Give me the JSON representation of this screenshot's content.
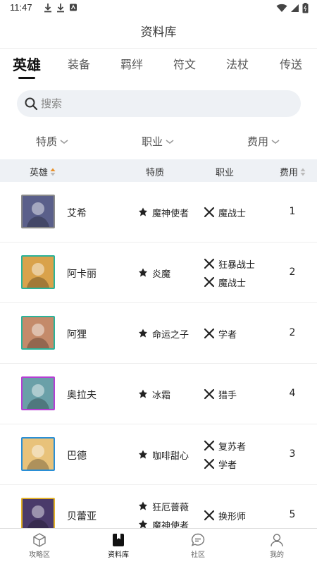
{
  "status": {
    "time": "11:47"
  },
  "header": {
    "title": "资料库"
  },
  "tabs": [
    {
      "label": "英雄",
      "active": true
    },
    {
      "label": "装备"
    },
    {
      "label": "羁绊"
    },
    {
      "label": "符文"
    },
    {
      "label": "法杖"
    },
    {
      "label": "传送"
    }
  ],
  "search": {
    "placeholder": "搜索"
  },
  "filters": {
    "trait": "特质",
    "class": "职业",
    "cost": "费用"
  },
  "table_header": {
    "hero": "英雄",
    "trait": "特质",
    "class": "职业",
    "cost": "费用"
  },
  "heroes": [
    {
      "name": "艾希",
      "traits": [
        "魔神使者"
      ],
      "classes": [
        "魔战士"
      ],
      "cost": "1",
      "frame_color": "#8a8a8a"
    },
    {
      "name": "阿卡丽",
      "traits": [
        "炎魔"
      ],
      "classes": [
        "狂暴战士",
        "魔战士"
      ],
      "cost": "2",
      "frame_color": "#2bb39a"
    },
    {
      "name": "阿狸",
      "traits": [
        "命运之子"
      ],
      "classes": [
        "学者"
      ],
      "cost": "2",
      "frame_color": "#2bb39a"
    },
    {
      "name": "奥拉夫",
      "traits": [
        "冰霜"
      ],
      "classes": [
        "猎手"
      ],
      "cost": "4",
      "frame_color": "#b53fd3"
    },
    {
      "name": "巴德",
      "traits": [
        "咖啡甜心"
      ],
      "classes": [
        "复苏者",
        "学者"
      ],
      "cost": "3",
      "frame_color": "#2a8fd6"
    },
    {
      "name": "贝蕾亚",
      "traits": [
        "狂厄蔷薇",
        "魔神使者"
      ],
      "classes": [
        "换形师"
      ],
      "cost": "5",
      "frame_color": "#e3b22a"
    }
  ],
  "bottom_nav": [
    {
      "label": "攻略区",
      "icon": "cube-icon"
    },
    {
      "label": "资料库",
      "icon": "book-icon",
      "active": true
    },
    {
      "label": "社区",
      "icon": "chat-icon"
    },
    {
      "label": "我的",
      "icon": "user-icon"
    }
  ]
}
